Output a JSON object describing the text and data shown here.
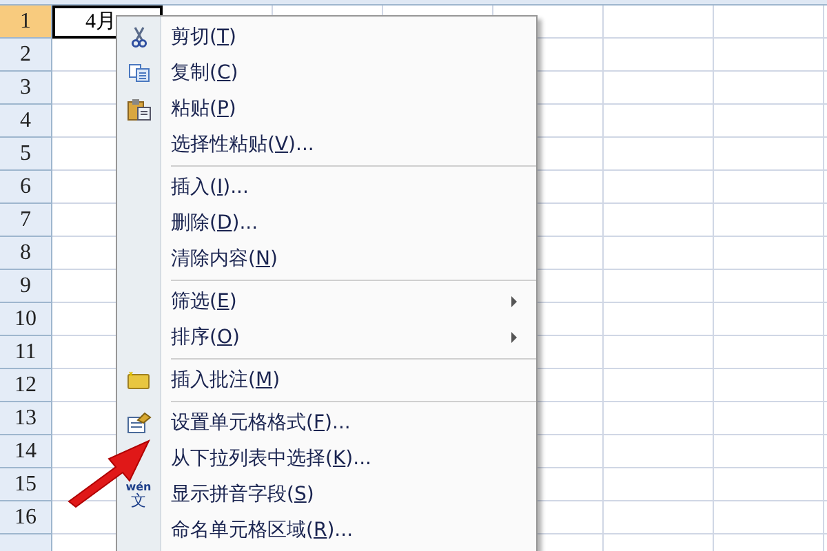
{
  "rows": [
    {
      "label": "1",
      "selected": true
    },
    {
      "label": "2",
      "selected": false
    },
    {
      "label": "3",
      "selected": false
    },
    {
      "label": "4",
      "selected": false
    },
    {
      "label": "5",
      "selected": false
    },
    {
      "label": "6",
      "selected": false
    },
    {
      "label": "7",
      "selected": false
    },
    {
      "label": "8",
      "selected": false
    },
    {
      "label": "9",
      "selected": false
    },
    {
      "label": "10",
      "selected": false
    },
    {
      "label": "11",
      "selected": false
    },
    {
      "label": "12",
      "selected": false
    },
    {
      "label": "13",
      "selected": false
    },
    {
      "label": "14",
      "selected": false
    },
    {
      "label": "15",
      "selected": false
    },
    {
      "label": "16",
      "selected": false
    }
  ],
  "active_cell": {
    "value": "4月"
  },
  "context_menu": {
    "groups": [
      [
        {
          "label": "剪切(T)",
          "submenu": false
        },
        {
          "label": "复制(C)",
          "submenu": false
        },
        {
          "label": "粘贴(P)",
          "submenu": false
        },
        {
          "label": "选择性粘贴(V)...",
          "submenu": false
        }
      ],
      [
        {
          "label": "插入(I)...",
          "submenu": false
        },
        {
          "label": "删除(D)...",
          "submenu": false
        },
        {
          "label": "清除内容(N)",
          "submenu": false
        }
      ],
      [
        {
          "label": "筛选(E)",
          "submenu": true
        },
        {
          "label": "排序(O)",
          "submenu": true
        }
      ],
      [
        {
          "label": "插入批注(M)",
          "submenu": false
        }
      ],
      [
        {
          "label": "设置单元格格式(F)...",
          "submenu": false
        },
        {
          "label": "从下拉列表中选择(K)...",
          "submenu": false
        },
        {
          "label": "显示拼音字段(S)",
          "icon_ruby": "wén",
          "icon_text": "文",
          "submenu": false
        },
        {
          "label": "命名单元格区域(R)...",
          "submenu": false
        }
      ]
    ]
  },
  "annotation": {
    "kind": "arrow"
  }
}
